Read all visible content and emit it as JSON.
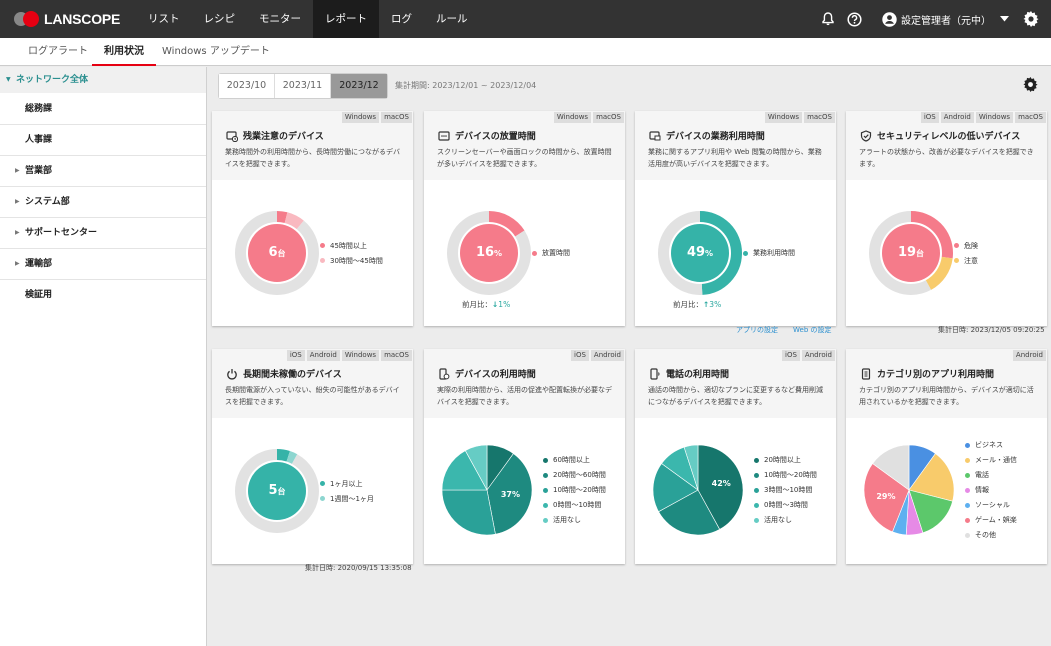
{
  "header": {
    "logo_text": "LANSCOPE",
    "nav": [
      "リスト",
      "レシピ",
      "モニター",
      "レポート",
      "ログ",
      "ルール"
    ],
    "user_name": "設定管理者（元中）",
    "icons": [
      "bell-icon",
      "help-icon",
      "user-icon",
      "chevron-down-icon",
      "gear-icon"
    ]
  },
  "subtabs": [
    "ログアラート",
    "利用状況",
    "Windows アップデート"
  ],
  "sidebar": {
    "root": "ネットワーク全体",
    "items": [
      {
        "label": "総務課",
        "expandable": false
      },
      {
        "label": "人事課",
        "expandable": false
      },
      {
        "label": "営業部",
        "expandable": true
      },
      {
        "label": "システム部",
        "expandable": true
      },
      {
        "label": "サポートセンター",
        "expandable": true
      },
      {
        "label": "運輸部",
        "expandable": true
      },
      {
        "label": "検証用",
        "expandable": false
      }
    ]
  },
  "toolbar": {
    "months": [
      "2023/10",
      "2023/11",
      "2023/12"
    ],
    "selected_month": "2023/12",
    "period": "集計期間: 2023/12/01 ~ 2023/12/04"
  },
  "cards": [
    {
      "id": "overtime",
      "os": [
        "Windows",
        "macOS"
      ],
      "title": "残業注意のデバイス",
      "desc": "業務時間外の利用時間から、長時間労働につながるデバイスを把握できます。",
      "chart": {
        "type": "donut",
        "center_value": "6",
        "center_unit": "台",
        "center_color": "#f57b8a",
        "series": [
          {
            "name": "45時間以上",
            "value": 4,
            "color": "#f57b8a"
          },
          {
            "name": "30時間〜45時間",
            "value": 7,
            "color": "#f9b9c0"
          },
          {
            "name": "",
            "value": 89,
            "color": "#e2e2e2"
          }
        ]
      }
    },
    {
      "id": "idle",
      "os": [
        "Windows",
        "macOS"
      ],
      "title": "デバイスの放置時間",
      "desc": "スクリーンセーバーや画面ロックの時間から、放置時間が多いデバイスを把握できます。",
      "chart": {
        "type": "donut",
        "center_value": "16",
        "center_unit": "%",
        "center_color": "#f57b8a",
        "series": [
          {
            "name": "放置時間",
            "value": 16,
            "color": "#f57b8a"
          },
          {
            "name": "",
            "value": 84,
            "color": "#e2e2e2"
          }
        ]
      },
      "diff_label": "前月比：",
      "diff_arrow": "↓",
      "diff_value": "1%"
    },
    {
      "id": "business",
      "os": [
        "Windows",
        "macOS"
      ],
      "title": "デバイスの業務利用時間",
      "desc": "業務に関するアプリ利用や Web 閲覧の時間から、業務活用度が高いデバイスを把握できます。",
      "chart": {
        "type": "donut",
        "center_value": "49",
        "center_unit": "%",
        "center_color": "#35b3a8",
        "series": [
          {
            "name": "業務利用時間",
            "value": 49,
            "color": "#35b3a8"
          },
          {
            "name": "",
            "value": 51,
            "color": "#e2e2e2"
          }
        ]
      },
      "diff_label": "前月比：",
      "diff_arrow": "↑",
      "diff_value": "3%"
    },
    {
      "id": "security",
      "os": [
        "iOS",
        "Android",
        "Windows",
        "macOS"
      ],
      "title": "セキュリティレベルの低いデバイス",
      "desc": "アラートの状態から、改善が必要なデバイスを把握できます。",
      "chart": {
        "type": "donut",
        "center_value": "19",
        "center_unit": "台",
        "center_color": "#f57b8a",
        "series": [
          {
            "name": "危険",
            "value": 27,
            "color": "#f57b8a"
          },
          {
            "name": "注意",
            "value": 15,
            "color": "#f8cb6b"
          },
          {
            "name": "",
            "value": 58,
            "color": "#e2e2e2"
          }
        ]
      }
    },
    {
      "id": "longunused",
      "os": [
        "iOS",
        "Android",
        "Windows",
        "macOS"
      ],
      "title": "長期間未稼働のデバイス",
      "desc": "長期間電源が入っていない、紛失の可能性があるデバイスを把握できます。",
      "chart": {
        "type": "donut",
        "center_value": "5",
        "center_unit": "台",
        "center_color": "#35b3a8",
        "series": [
          {
            "name": "1ヶ月以上",
            "value": 5,
            "color": "#35b3a8"
          },
          {
            "name": "1週間〜1ヶ月",
            "value": 3,
            "color": "#8dd6d0"
          },
          {
            "name": "",
            "value": 92,
            "color": "#e2e2e2"
          }
        ]
      }
    },
    {
      "id": "usage",
      "os": [
        "iOS",
        "Android"
      ],
      "title": "デバイスの利用時間",
      "desc": "実際の利用時間から、活用の促進や配置転換が必要なデバイスを把握できます。",
      "chart": {
        "type": "pie",
        "label": "37%",
        "series": [
          {
            "name": "60時間以上",
            "value": 10,
            "color": "#16766c"
          },
          {
            "name": "20時間〜60時間",
            "value": 37,
            "color": "#1e8a80"
          },
          {
            "name": "10時間〜20時間",
            "value": 28,
            "color": "#2aa198"
          },
          {
            "name": "0時間〜10時間",
            "value": 17,
            "color": "#3bb7ad"
          },
          {
            "name": "活用なし",
            "value": 8,
            "color": "#66ccc4"
          }
        ]
      }
    },
    {
      "id": "phone",
      "os": [
        "iOS",
        "Android"
      ],
      "title": "電話の利用時間",
      "desc": "通話の時間から、適切なプランに変更するなど費用削減につながるデバイスを把握できます。",
      "chart": {
        "type": "pie",
        "label": "42%",
        "series": [
          {
            "name": "20時間以上",
            "value": 42,
            "color": "#16766c"
          },
          {
            "name": "10時間〜20時間",
            "value": 25,
            "color": "#1e8a80"
          },
          {
            "name": "3時間〜10時間",
            "value": 18,
            "color": "#2aa198"
          },
          {
            "name": "0時間〜3時間",
            "value": 10,
            "color": "#3bb7ad"
          },
          {
            "name": "活用なし",
            "value": 5,
            "color": "#66ccc4"
          }
        ]
      }
    },
    {
      "id": "appcategory",
      "os": [
        "Android"
      ],
      "title": "カテゴリ別のアプリ利用時間",
      "desc": "カテゴリ別のアプリ利用時間から、デバイスが適切に活用されているかを把握できます。",
      "chart": {
        "type": "pie",
        "label": "29%",
        "series": [
          {
            "name": "ビジネス",
            "value": 10,
            "color": "#4a90e2"
          },
          {
            "name": "メール・通信",
            "value": 19,
            "color": "#f8cb6b"
          },
          {
            "name": "電話",
            "value": 16,
            "color": "#5cc86b"
          },
          {
            "name": "情報",
            "value": 6,
            "color": "#e68ae6"
          },
          {
            "name": "ソーシャル",
            "value": 5,
            "color": "#5eb0f0"
          },
          {
            "name": "ゲーム・娯楽",
            "value": 29,
            "color": "#f57b8a"
          },
          {
            "name": "その他",
            "value": 15,
            "color": "#e0e0e0"
          }
        ]
      }
    }
  ],
  "links": {
    "app_settings": "アプリの設定",
    "web_settings": "Web の設定"
  },
  "footnotes": {
    "row1": "集計日時: 2023/12/05 09:20:25",
    "row2": "集計日時: 2020/09/15 13:35:08"
  }
}
